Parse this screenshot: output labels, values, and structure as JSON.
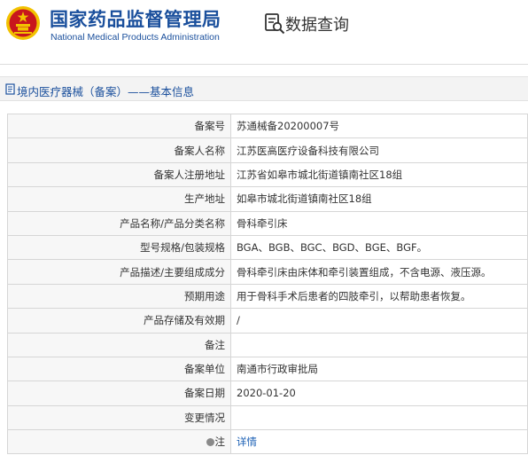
{
  "header": {
    "org_name_cn": "国家药品监督管理局",
    "org_name_en": "National Medical Products Administration",
    "data_query_label": "数据查询"
  },
  "breadcrumb": {
    "text": "境内医疗器械（备案）——基本信息"
  },
  "colors": {
    "brand_blue": "#1a4f9c",
    "emblem_red": "#c8161d",
    "emblem_gold": "#f2c200",
    "link_blue": "#1a5fb4"
  },
  "icons": [
    "national-emblem-icon",
    "data-query-icon",
    "document-icon",
    "note-icon"
  ],
  "rows": [
    {
      "label": "备案号",
      "value": "苏通械备20200007号"
    },
    {
      "label": "备案人名称",
      "value": "江苏医高医疗设备科技有限公司"
    },
    {
      "label": "备案人注册地址",
      "value": "江苏省如皋市城北街道镇南社区18组"
    },
    {
      "label": "生产地址",
      "value": "如皋市城北街道镇南社区18组"
    },
    {
      "label": "产品名称/产品分类名称",
      "value": "骨科牵引床"
    },
    {
      "label": "型号规格/包装规格",
      "value": "BGA、BGB、BGC、BGD、BGE、BGF。"
    },
    {
      "label": "产品描述/主要组成成分",
      "value": "骨科牵引床由床体和牵引装置组成，不含电源、液压源。"
    },
    {
      "label": "预期用途",
      "value": "用于骨科手术后患者的四肢牵引，以帮助患者恢复。"
    },
    {
      "label": "产品存储及有效期",
      "value": "/"
    },
    {
      "label": "备注",
      "value": ""
    },
    {
      "label": "备案单位",
      "value": "南通市行政审批局"
    },
    {
      "label": "备案日期",
      "value": "2020-01-20"
    },
    {
      "label": "变更情况",
      "value": ""
    }
  ],
  "note_row": {
    "label": "注",
    "link": "详情"
  }
}
